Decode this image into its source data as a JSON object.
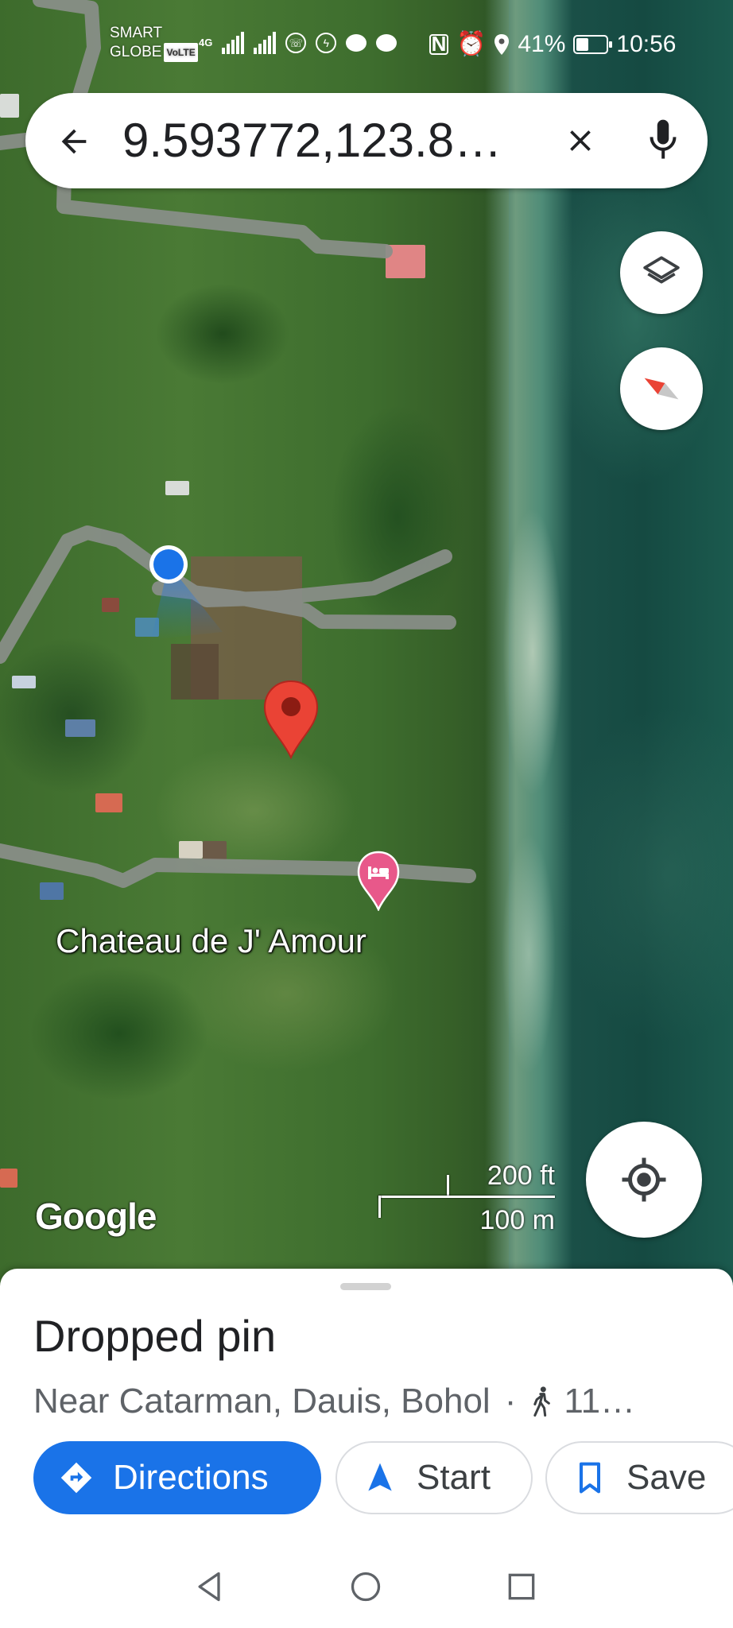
{
  "status_bar": {
    "carrier_line1": "SMART",
    "carrier_line2": "GLOBE",
    "volte": "VoLTE",
    "network": "4G",
    "battery": "41%",
    "battery_level": 0.41,
    "time": "10:56"
  },
  "search": {
    "query": "9.593772,123.8…"
  },
  "map": {
    "place_label": "Chateau de J' Amour",
    "attribution": "Google",
    "scale_imperial": "200 ft",
    "scale_metric": "100 m",
    "colors": {
      "pin": "#ea4335",
      "hotel_marker": "#e8588a",
      "my_location": "#1a73e8"
    }
  },
  "sheet": {
    "title": "Dropped pin",
    "location": "Near Catarman, Dauis, Bohol",
    "separator": "·",
    "walk_time": "11…",
    "actions": {
      "directions": "Directions",
      "start": "Start",
      "save": "Save"
    }
  },
  "colors": {
    "accent": "#1a73e8"
  }
}
